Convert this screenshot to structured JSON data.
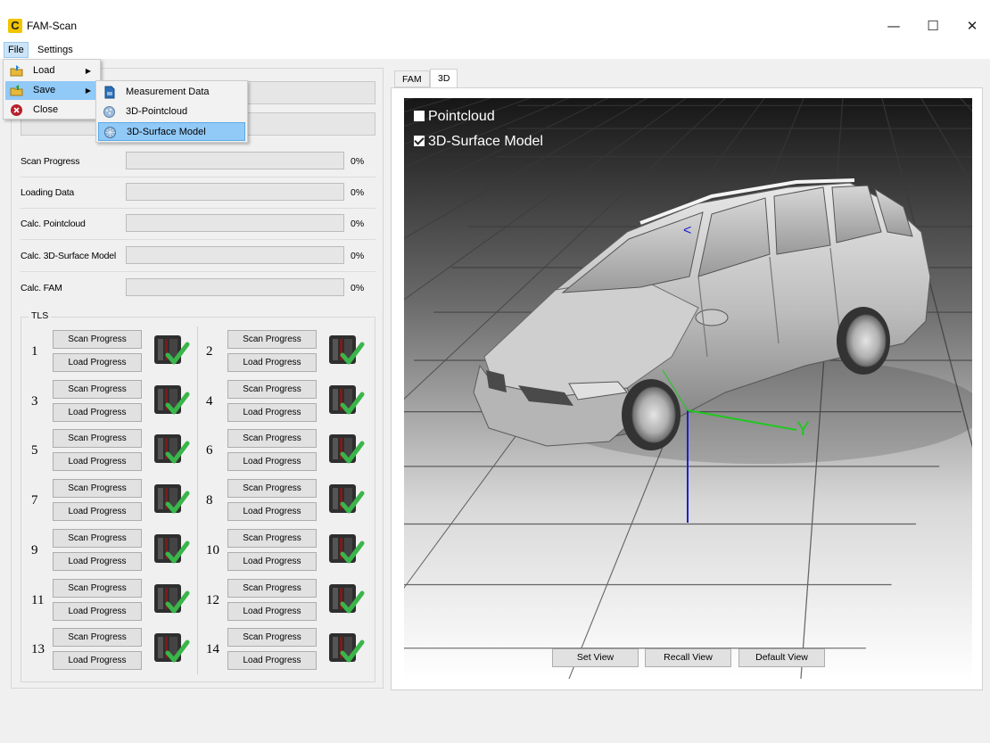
{
  "app": {
    "title": "FAM-Scan",
    "icon_letter": "C"
  },
  "window_controls": {
    "minimize": "—",
    "maximize": "☐",
    "close": "✕"
  },
  "menubar": {
    "file": "File",
    "settings": "Settings"
  },
  "file_menu": {
    "items": [
      {
        "label": "Load",
        "icon": "folder-load-icon",
        "has_submenu": true
      },
      {
        "label": "Save",
        "icon": "folder-save-icon",
        "has_submenu": true,
        "highlighted": true
      },
      {
        "label": "Close",
        "icon": "close-circle-icon",
        "has_submenu": false
      }
    ]
  },
  "save_submenu": {
    "items": [
      {
        "label": "Measurement Data",
        "icon": "document-icon"
      },
      {
        "label": "3D-Pointcloud",
        "icon": "pointcloud-icon"
      },
      {
        "label": "3D-Surface Model",
        "icon": "surface-model-icon",
        "highlighted": true
      }
    ]
  },
  "progress": [
    {
      "label": "Scan Progress",
      "percent": "0%",
      "value": 0
    },
    {
      "label": "Loading Data",
      "percent": "0%",
      "value": 0
    },
    {
      "label": "Calc. Pointcloud",
      "percent": "0%",
      "value": 0
    },
    {
      "label": "Calc. 3D-Surface Model",
      "percent": "0%",
      "value": 0
    },
    {
      "label": "Calc. FAM",
      "percent": "0%",
      "value": 0
    }
  ],
  "tls": {
    "title": "TLS",
    "scan_label": "Scan Progress",
    "load_label": "Load Progress",
    "units": [
      "1",
      "2",
      "3",
      "4",
      "5",
      "6",
      "7",
      "8",
      "9",
      "10",
      "11",
      "12",
      "13",
      "14"
    ],
    "status_icon": "scanner-check-icon"
  },
  "tabs": {
    "fam": "FAM",
    "three_d": "3D"
  },
  "viewport": {
    "pointcloud_label": "Pointcloud",
    "pointcloud_checked": false,
    "surface_label": "3D-Surface Model",
    "surface_checked": true,
    "axis_y_label": "Y",
    "axis_x_label": "<",
    "model": "car-surface-model"
  },
  "view_buttons": {
    "set": "Set View",
    "recall": "Recall View",
    "default": "Default View"
  },
  "colors": {
    "accent_highlight": "#91c9f7",
    "check_green": "#3ab54a",
    "axis_blue": "#1f1fd0",
    "axis_green": "#1ec81e"
  }
}
